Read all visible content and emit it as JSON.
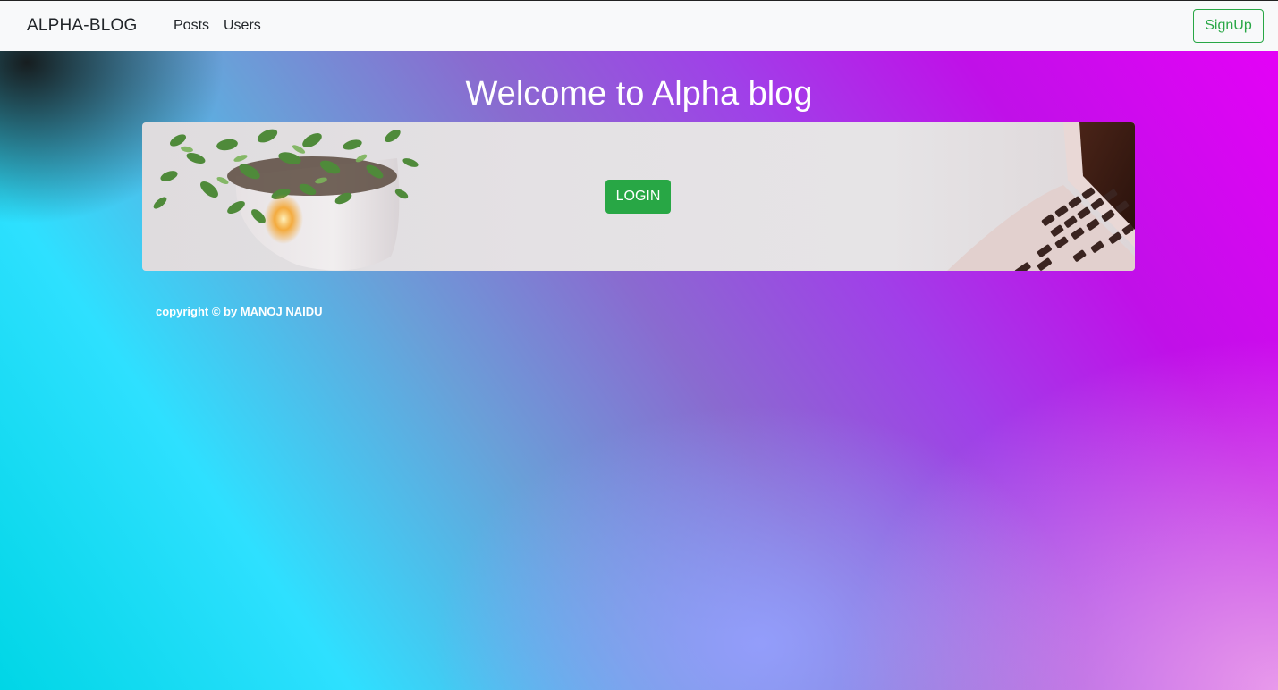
{
  "navbar": {
    "brand": "ALPHA-BLOG",
    "links": [
      {
        "label": "Posts"
      },
      {
        "label": "Users"
      }
    ],
    "signup_label": "SignUp",
    "accent_color": "#28a745"
  },
  "hero": {
    "title": "Welcome to Alpha blog",
    "login_label": "LOGIN"
  },
  "footer": {
    "copyright": "copyright © by MANOJ NAIDU"
  },
  "icons": [
    "potted-plant-image",
    "laptop-image"
  ]
}
